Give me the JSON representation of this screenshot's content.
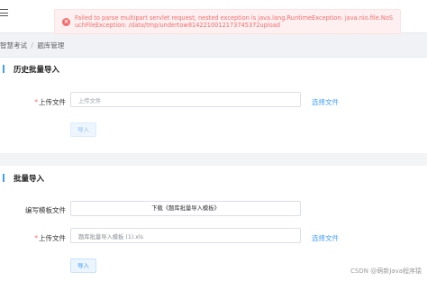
{
  "header": {
    "menu_icon": "hamburger-icon"
  },
  "breadcrumb": {
    "items": [
      "智慧考试",
      "题库管理"
    ],
    "separator": "/"
  },
  "alert": {
    "icon": "error-circle-icon",
    "message": "Failed to parse multipart servlet request; nested exception is java.lang.RuntimeException: java.nio.file.NoSuchFileException: /data/tmp/undertow8142210012173745372upload"
  },
  "history_import": {
    "title": "历史批量导入",
    "upload_label": "上传文件",
    "required_mark": "*",
    "upload_placeholder": "上传文件",
    "select_link": "选择文件",
    "import_button": "导入"
  },
  "batch_import": {
    "title": "批量导入",
    "template_label": "编写模板文件",
    "download_text": "下载《题库批量导入模板》",
    "upload_label": "上传文件",
    "required_mark": "*",
    "upload_value": "题库批量导入模板 (1).xls",
    "select_link": "选择文件",
    "import_button": "导入"
  },
  "watermark": "CSDN @萌新Java程序猿",
  "colors": {
    "accent": "#409eff",
    "error": "#f56c6c",
    "error_bg": "#fef0f0"
  }
}
